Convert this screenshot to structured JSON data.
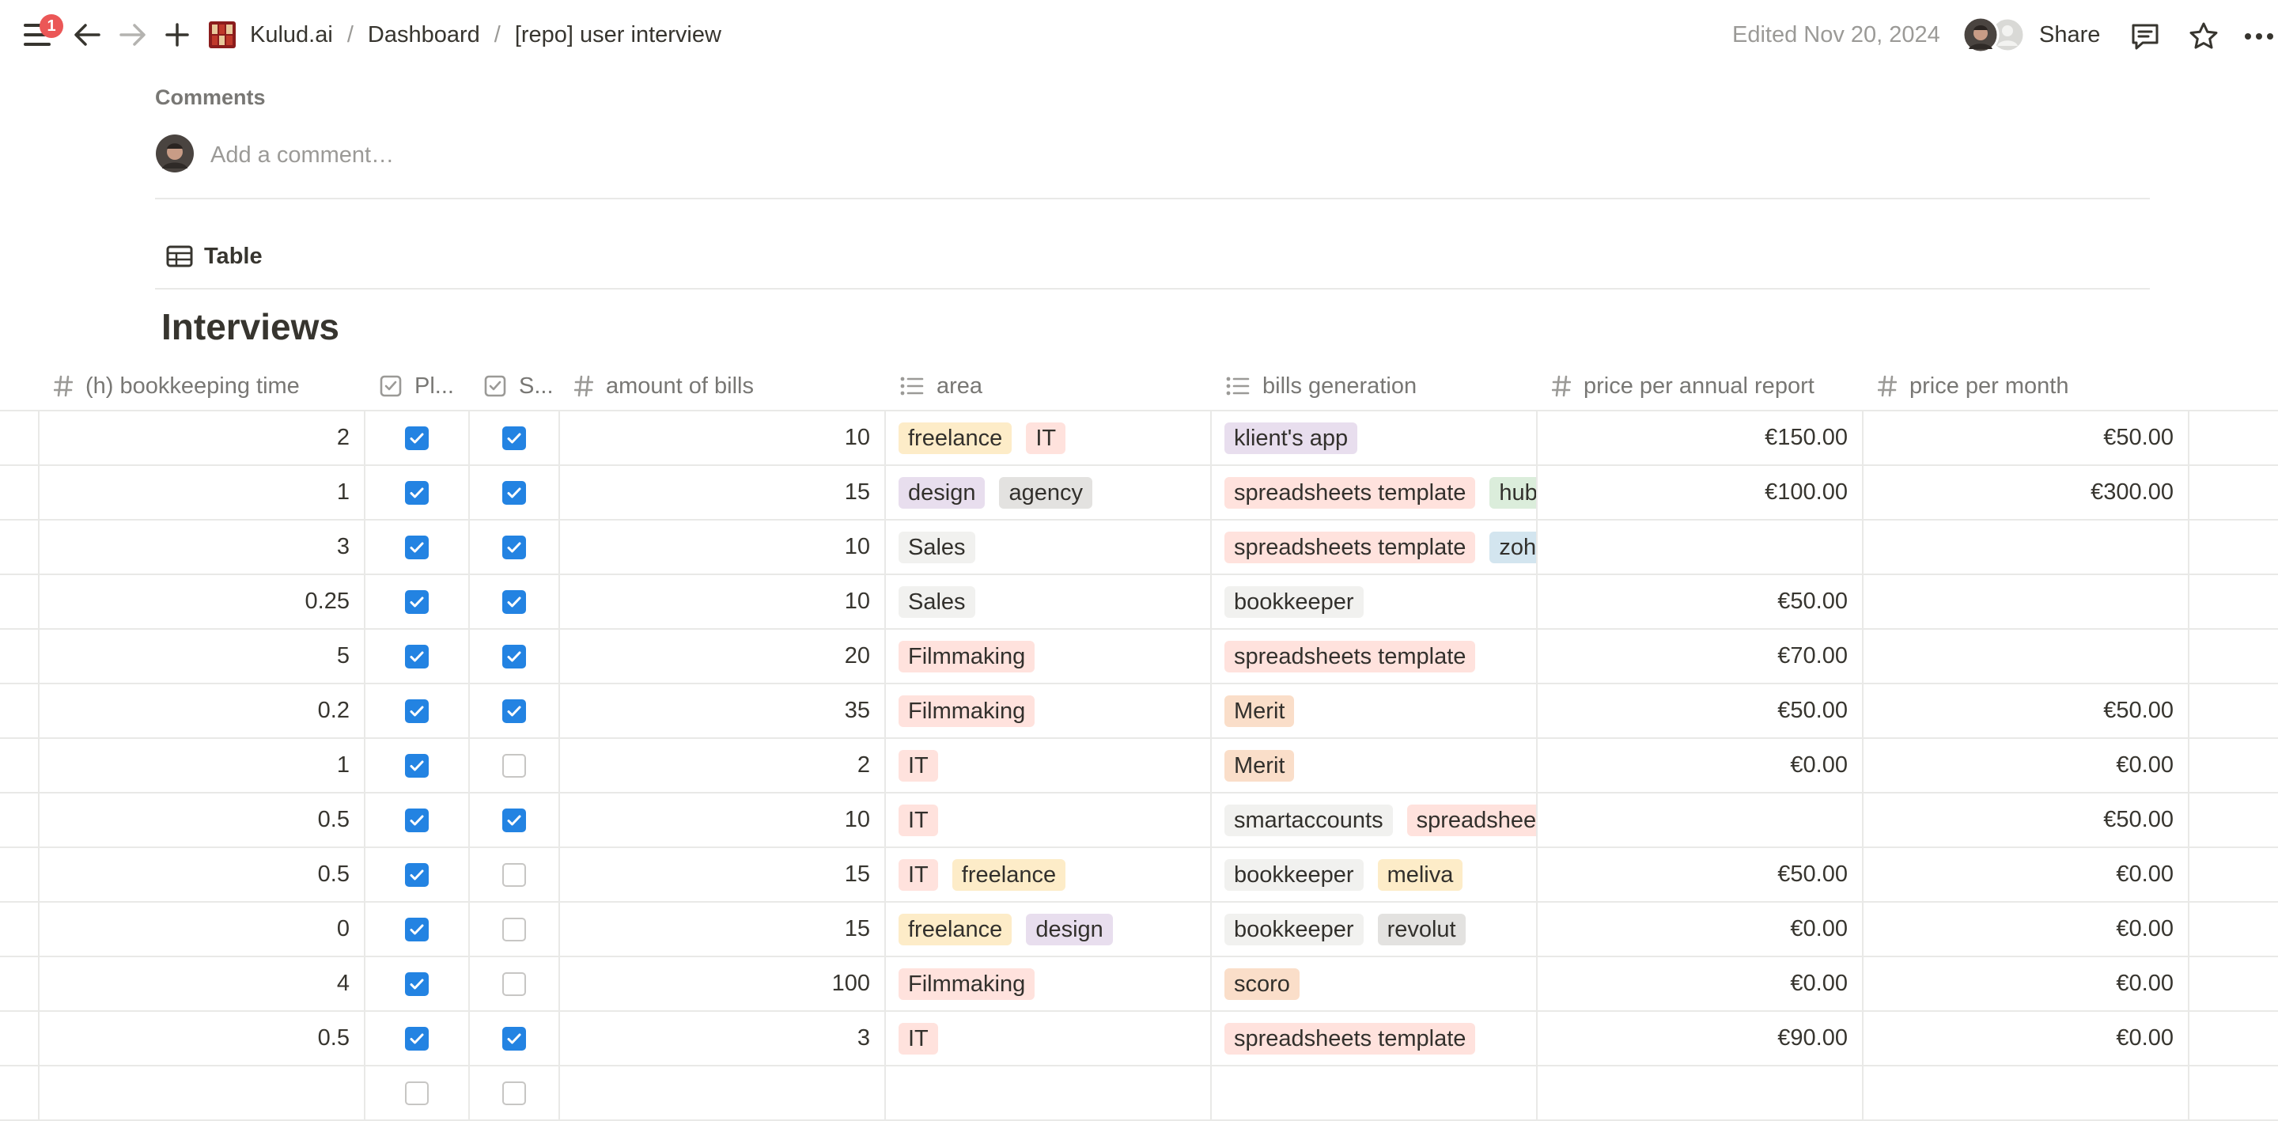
{
  "topbar": {
    "notification_count": "1",
    "breadcrumb": [
      "Kulud.ai",
      "Dashboard",
      "[repo] user interview"
    ],
    "edited": "Edited Nov 20, 2024",
    "share_label": "Share"
  },
  "comments": {
    "title": "Comments",
    "placeholder": "Add a comment…"
  },
  "view": {
    "tab_label": "Table"
  },
  "database": {
    "title": "Interviews",
    "columns": [
      {
        "icon": "number-icon",
        "label": "(h) bookkeeping time"
      },
      {
        "icon": "checkbox-icon",
        "label": "Pl..."
      },
      {
        "icon": "checkbox-icon",
        "label": "S..."
      },
      {
        "icon": "number-icon",
        "label": "amount of bills"
      },
      {
        "icon": "list-icon",
        "label": "area"
      },
      {
        "icon": "list-icon",
        "label": "bills generation"
      },
      {
        "icon": "number-icon",
        "label": "price per annual report"
      },
      {
        "icon": "number-icon",
        "label": "price per month"
      }
    ],
    "rows": [
      {
        "time": "2",
        "pl": true,
        "s": true,
        "bills": "10",
        "area": [
          "freelance",
          "IT"
        ],
        "gen": [
          "klient's app"
        ],
        "annual": "€150.00",
        "month": "€50.00"
      },
      {
        "time": "1",
        "pl": true,
        "s": true,
        "bills": "15",
        "area": [
          "design",
          "agency"
        ],
        "gen": [
          "spreadsheets template",
          "hubspot"
        ],
        "annual": "€100.00",
        "month": "€300.00"
      },
      {
        "time": "3",
        "pl": true,
        "s": true,
        "bills": "10",
        "area": [
          "Sales"
        ],
        "gen": [
          "spreadsheets template",
          "zoho"
        ],
        "annual": "",
        "month": ""
      },
      {
        "time": "0.25",
        "pl": true,
        "s": true,
        "bills": "10",
        "area": [
          "Sales"
        ],
        "gen": [
          "bookkeeper"
        ],
        "annual": "€50.00",
        "month": ""
      },
      {
        "time": "5",
        "pl": true,
        "s": true,
        "bills": "20",
        "area": [
          "Filmmaking"
        ],
        "gen": [
          "spreadsheets template"
        ],
        "annual": "€70.00",
        "month": ""
      },
      {
        "time": "0.2",
        "pl": true,
        "s": true,
        "bills": "35",
        "area": [
          "Filmmaking"
        ],
        "gen": [
          "Merit"
        ],
        "annual": "€50.00",
        "month": "€50.00"
      },
      {
        "time": "1",
        "pl": true,
        "s": false,
        "bills": "2",
        "area": [
          "IT"
        ],
        "gen": [
          "Merit"
        ],
        "annual": "€0.00",
        "month": "€0.00"
      },
      {
        "time": "0.5",
        "pl": true,
        "s": true,
        "bills": "10",
        "area": [
          "IT"
        ],
        "gen": [
          "smartaccounts",
          "spreadsheets template"
        ],
        "annual": "",
        "month": "€50.00"
      },
      {
        "time": "0.5",
        "pl": true,
        "s": false,
        "bills": "15",
        "area": [
          "IT",
          "freelance"
        ],
        "gen": [
          "bookkeeper",
          "meliva"
        ],
        "annual": "€50.00",
        "month": "€0.00"
      },
      {
        "time": "0",
        "pl": true,
        "s": false,
        "bills": "15",
        "area": [
          "freelance",
          "design"
        ],
        "gen": [
          "bookkeeper",
          "revolut"
        ],
        "annual": "€0.00",
        "month": "€0.00"
      },
      {
        "time": "4",
        "pl": true,
        "s": false,
        "bills": "100",
        "area": [
          "Filmmaking"
        ],
        "gen": [
          "scoro"
        ],
        "annual": "€0.00",
        "month": "€0.00"
      },
      {
        "time": "0.5",
        "pl": true,
        "s": true,
        "bills": "3",
        "area": [
          "IT"
        ],
        "gen": [
          "spreadsheets template"
        ],
        "annual": "€90.00",
        "month": "€0.00"
      },
      {
        "time": "",
        "pl": false,
        "s": false,
        "bills": "",
        "area": [],
        "gen": [],
        "annual": "",
        "month": ""
      }
    ],
    "tag_colors": {
      "freelance": "#fdecc8",
      "IT": "#ffe2dd",
      "design": "#e8deee",
      "agency": "#e3e2e0",
      "Sales": "#f1f1ef",
      "Filmmaking": "#ffe2dd",
      "klient's app": "#e8deee",
      "spreadsheets template": "#ffe2dd",
      "hubspot": "#dbeddb",
      "zoho": "#d3e5ef",
      "bookkeeper": "#f1f1ef",
      "Merit": "#fadec9",
      "smartaccounts": "#f1f1ef",
      "meliva": "#fdecc8",
      "revolut": "#e3e2e0",
      "scoro": "#fadec9"
    }
  }
}
